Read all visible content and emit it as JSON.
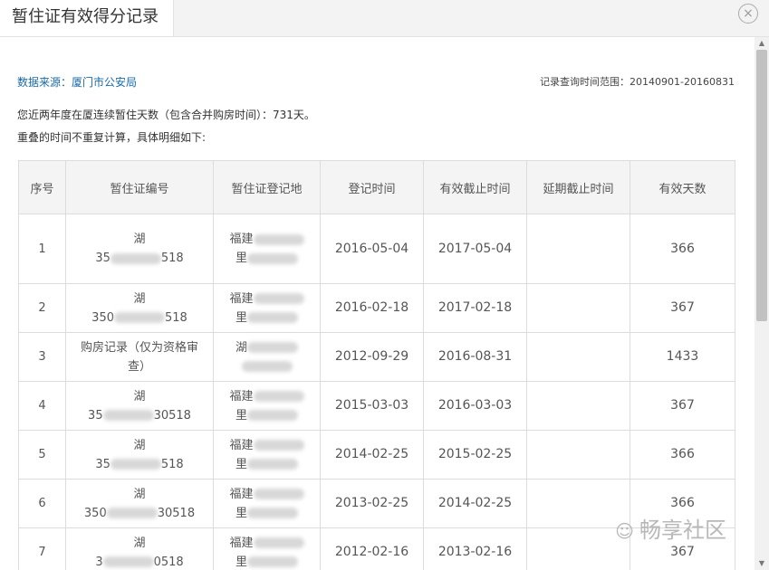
{
  "dialog": {
    "title": "暂住证有效得分记录",
    "close_glyph": "×"
  },
  "meta": {
    "source": "数据来源：厦门市公安局",
    "query_range": "记录查询时间范围：20140901-20160831"
  },
  "notes": {
    "line1": "您近两年度在厦连续暂住天数（包含合并购房时间）：731天。",
    "line2": "重叠的时间不重复计算，具体明细如下:"
  },
  "table": {
    "headers": [
      "序号",
      "暂住证编号",
      "暂住证登记地",
      "登记时间",
      "有效截止时间",
      "延期截止时间",
      "有效天数"
    ],
    "rows": [
      {
        "seq": "1",
        "id_line1": "湖",
        "id_line2": "35",
        "id_tail": "518",
        "place": "福建",
        "place_line2": "里",
        "reg": "2016-05-04",
        "valid": "2017-05-04",
        "ext": "",
        "days": "366"
      },
      {
        "seq": "2",
        "id_line1": "湖",
        "id_line2": "350",
        "id_tail": "518",
        "place": "福建",
        "place_line2": "里",
        "reg": "2016-02-18",
        "valid": "2017-02-18",
        "ext": "",
        "days": "367"
      },
      {
        "seq": "3",
        "id_line1": "购房记录（仅为资格审",
        "id_line2": "查）",
        "id_tail": "",
        "place": "湖",
        "place_line2": "",
        "reg": "2012-09-29",
        "valid": "2016-08-31",
        "ext": "",
        "days": "1433"
      },
      {
        "seq": "4",
        "id_line1": "湖",
        "id_line2": "35",
        "id_tail": "30518",
        "place": "福建",
        "place_line2": "里",
        "reg": "2015-03-03",
        "valid": "2016-03-03",
        "ext": "",
        "days": "367"
      },
      {
        "seq": "5",
        "id_line1": "湖",
        "id_line2": "35",
        "id_tail": "518",
        "place": "福建",
        "place_line2": "里",
        "reg": "2014-02-25",
        "valid": "2015-02-25",
        "ext": "",
        "days": "366"
      },
      {
        "seq": "6",
        "id_line1": "湖",
        "id_line2": "350",
        "id_tail": "30518",
        "place": "福建",
        "place_line2": "里",
        "reg": "2013-02-25",
        "valid": "2014-02-25",
        "ext": "",
        "days": "366"
      },
      {
        "seq": "7",
        "id_line1": "湖",
        "id_line2": "3",
        "id_tail": "0518",
        "place": "福建",
        "place_line2": "里",
        "reg": "2012-02-16",
        "valid": "2013-02-16",
        "ext": "",
        "days": "367"
      }
    ]
  },
  "watermark": {
    "text": "畅享社区",
    "icon": "wechat-icon"
  }
}
